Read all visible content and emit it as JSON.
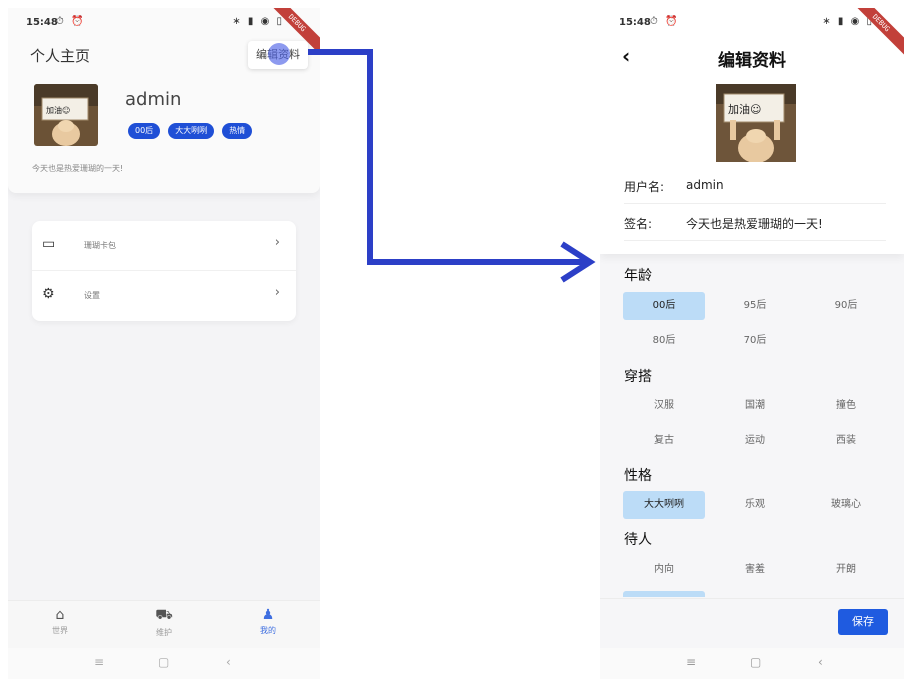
{
  "left": {
    "status": {
      "time": "15:48",
      "left_icons": "⏱ ⏰",
      "right_icons": "∗ ▮ ◉ ▯",
      "debug_ribbon": "DEBUG"
    },
    "header": {
      "title": "个人主页",
      "edit_button": "编辑资料"
    },
    "profile": {
      "username": "admin",
      "tags": [
        "00后",
        "大大咧咧",
        "热情"
      ],
      "signature": "今天也是热爱珊瑚的一天!"
    },
    "menu": [
      {
        "icon": "wallet-icon",
        "glyph": "▭",
        "label": "珊瑚卡包",
        "arrow": "›"
      },
      {
        "icon": "gear-icon",
        "glyph": "⚙",
        "label": "设置",
        "arrow": "›"
      }
    ],
    "tabs": [
      {
        "icon": "home-icon",
        "glyph": "⌂",
        "label": "世界"
      },
      {
        "icon": "cart-icon",
        "glyph": "⛟",
        "label": "维护"
      },
      {
        "icon": "person-icon",
        "glyph": "♟",
        "label": "我的",
        "active": true
      }
    ],
    "sysnav": {
      "menu": "≡",
      "home": "▢",
      "back": "‹"
    }
  },
  "right": {
    "status": {
      "time": "15:48",
      "left_icons": "⏱ ⏰",
      "right_icons": "∗ ▮ ◉ ▯",
      "debug_ribbon": "DEBUG"
    },
    "header": {
      "back": "‹",
      "title": "编辑资料"
    },
    "avatar_text": "加油☺",
    "fields": [
      {
        "label": "用户名:",
        "value": "admin"
      },
      {
        "label": "签名:",
        "value": "今天也是热爱珊瑚的一天!"
      }
    ],
    "sections": [
      {
        "title": "年龄",
        "options": [
          "00后",
          "95后",
          "90后",
          "80后",
          "70后"
        ],
        "selected": [
          "00后"
        ]
      },
      {
        "title": "穿搭",
        "options": [
          "汉服",
          "国潮",
          "撞色",
          "复古",
          "运动",
          "西装"
        ],
        "selected": []
      },
      {
        "title": "性格",
        "options": [
          "大大咧咧",
          "乐观",
          "玻璃心"
        ],
        "selected": [
          "大大咧咧"
        ]
      },
      {
        "title": "待人",
        "options": [
          "内向",
          "害羞",
          "开朗"
        ],
        "selected": []
      }
    ],
    "save_button": "保存",
    "sysnav": {
      "menu": "≡",
      "home": "▢",
      "back": "‹"
    }
  },
  "colors": {
    "accent": "#1f5be0",
    "tag": "#1f4fd6",
    "selected_option": "#bcdcf7",
    "arrow": "#2c3fc7"
  }
}
